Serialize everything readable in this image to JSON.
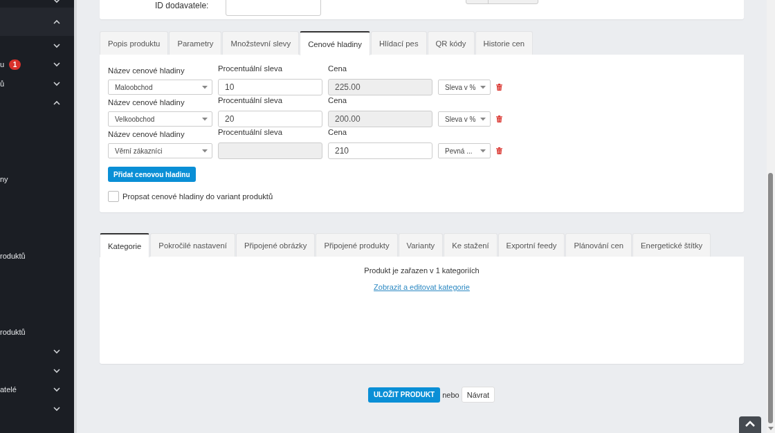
{
  "sidebar": {
    "items": [
      {
        "expanded": false,
        "selected": false
      },
      {
        "expanded": true,
        "selected": true
      },
      {
        "expanded": false,
        "selected": false
      },
      {
        "text": "u",
        "badge": "1",
        "expanded": false,
        "selected": false
      },
      {
        "text": "ů",
        "expanded": false,
        "selected": false
      },
      {
        "expanded": true,
        "selected": false
      },
      {
        "text": "ny",
        "selected": false
      },
      {
        "text": "roduktů",
        "selected": false
      },
      {
        "text": "roduktů",
        "selected": false
      },
      {
        "expanded": false,
        "selected": false
      },
      {
        "expanded": false,
        "selected": false
      },
      {
        "text": "atelé",
        "expanded": false,
        "selected": false
      },
      {
        "expanded": false,
        "selected": false
      }
    ]
  },
  "supplier_card": {
    "label": "ID dodavatele:"
  },
  "product_tabs": [
    {
      "label": "Popis produktu",
      "selected": false
    },
    {
      "label": "Parametry",
      "selected": false
    },
    {
      "label": "Množstevní slevy",
      "selected": false
    },
    {
      "label": "Cenové hladiny",
      "selected": true
    },
    {
      "label": "Hlídací pes",
      "selected": false
    },
    {
      "label": "QR kódy",
      "selected": false
    },
    {
      "label": "Historie cen",
      "selected": false
    }
  ],
  "price_levels": {
    "rows": [
      {
        "name_label": "Název cenové hladiny",
        "name": "Maloobchod",
        "percent_label": "Procentuální sleva",
        "percent": "10",
        "percent_disabled": false,
        "price_label": "Cena",
        "price": "225.00",
        "price_disabled": true,
        "type": "Sleva v %"
      },
      {
        "name_label": "Název cenové hladiny",
        "name": "Velkoobchod",
        "percent_label": "Procentuální sleva",
        "percent": "20",
        "percent_disabled": false,
        "price_label": "Cena",
        "price": "200.00",
        "price_disabled": true,
        "type": "Sleva v %"
      },
      {
        "name_label": "Název cenové hladiny",
        "name": "Věrní zákazníci",
        "percent_label": "Procentuální sleva",
        "percent_disabled": true,
        "price_label": "Cena",
        "price": "210",
        "price_disabled": false,
        "type": "Pevná ..."
      }
    ],
    "add_button": "Přidat cenovou hladinu",
    "propagate": {
      "label": "Propsat cenové hladiny do variant produktů",
      "checked": false
    }
  },
  "other_tabs": [
    {
      "label": "Kategorie",
      "selected": true
    },
    {
      "label": "Pokročilé nastavení",
      "selected": false
    },
    {
      "label": "Připojené obrázky",
      "selected": false
    },
    {
      "label": "Připojené produkty",
      "selected": false
    },
    {
      "label": "Varianty",
      "selected": false
    },
    {
      "label": "Ke stažení",
      "selected": false
    },
    {
      "label": "Exportní feedy",
      "selected": false
    },
    {
      "label": "Plánování cen",
      "selected": false
    },
    {
      "label": "Energetické štítky",
      "selected": false
    }
  ],
  "category_panel": {
    "info": "Produkt je zařazen v 1 kategoriích",
    "link": "Zobrazit a editovat kategorie"
  },
  "footer": {
    "save_button": "ULOŽIT PRODUKT",
    "separator": "nebo",
    "back_button": "Návrat"
  }
}
